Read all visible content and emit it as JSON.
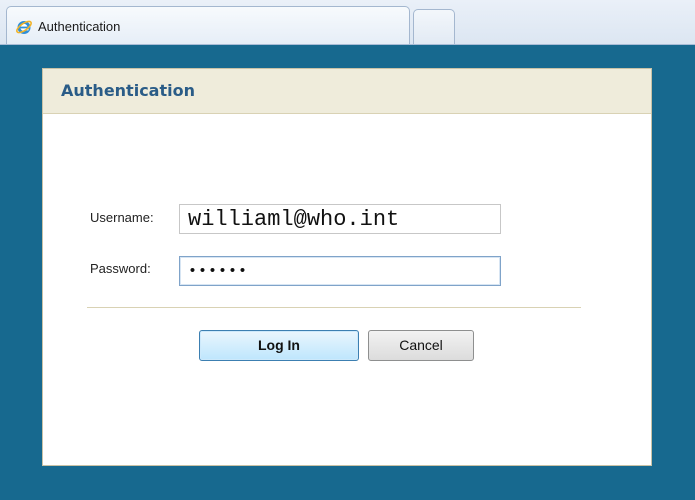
{
  "browser": {
    "tab_title": "Authentication"
  },
  "dialog": {
    "title": "Authentication",
    "username_label": "Username:",
    "username_value": "williaml@who.int",
    "password_label": "Password:",
    "password_masked": "••••••",
    "login_label": "Log In",
    "cancel_label": "Cancel"
  },
  "colors": {
    "page_background": "#17698f",
    "header_background": "#efecdb",
    "title_text": "#2a5c87"
  }
}
